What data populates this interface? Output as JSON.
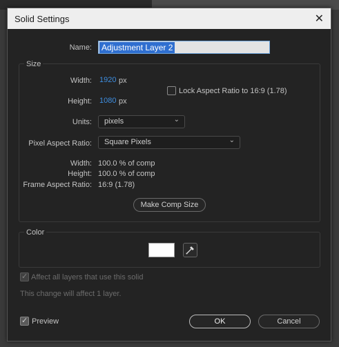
{
  "dialog": {
    "title": "Solid Settings",
    "close_icon": "close-icon"
  },
  "name": {
    "label": "Name:",
    "value": "Adjustment Layer 2"
  },
  "size": {
    "group_label": "Size",
    "width_label": "Width:",
    "width_value": "1920",
    "width_unit": "px",
    "height_label": "Height:",
    "height_value": "1080",
    "height_unit": "px",
    "lock_label": "Lock Aspect Ratio to 16:9 (1.78)",
    "lock_checked": false,
    "units_label": "Units:",
    "units_value": "pixels",
    "par_label": "Pixel Aspect Ratio:",
    "par_value": "Square Pixels",
    "info_width_label": "Width:",
    "info_width_value": "100.0 % of comp",
    "info_height_label": "Height:",
    "info_height_value": "100.0 % of comp",
    "info_far_label": "Frame Aspect Ratio:",
    "info_far_value": "16:9 (1.78)",
    "make_comp_size": "Make Comp Size"
  },
  "color": {
    "group_label": "Color",
    "swatch": "#ffffff",
    "eyedropper_icon": "eyedropper-icon"
  },
  "affect": {
    "label": "Affect all layers that use this solid",
    "checked": true,
    "note": "This change will affect 1 layer."
  },
  "footer": {
    "preview_label": "Preview",
    "preview_checked": true,
    "ok": "OK",
    "cancel": "Cancel"
  },
  "colors": {
    "accent": "#3e8ee0",
    "selection": "#2f6fd0",
    "background": "#232323"
  }
}
